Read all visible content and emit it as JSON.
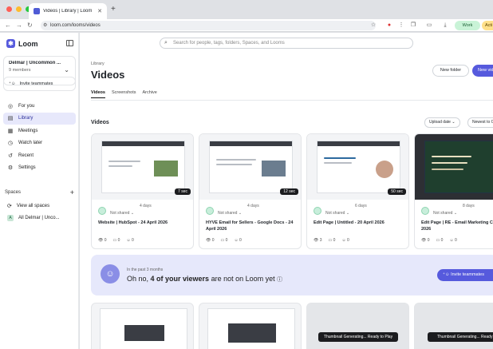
{
  "browser": {
    "tab_title": "Videos | Library | Loom",
    "url": "loom.com/looms/videos",
    "profile_work": "Work",
    "profile_acti": "Acti"
  },
  "sidebar": {
    "brand": "Loom",
    "workspace_name": "Delmar | Uncommon ...",
    "workspace_members": "9 members",
    "invite_label": "Invite teammates",
    "items": [
      {
        "label": "For you",
        "icon": "user-circle-icon"
      },
      {
        "label": "Library",
        "icon": "library-icon",
        "active": true
      },
      {
        "label": "Meetings",
        "icon": "calendar-icon"
      },
      {
        "label": "Watch later",
        "icon": "clock-icon"
      },
      {
        "label": "Recent",
        "icon": "history-icon"
      },
      {
        "label": "Settings",
        "icon": "gear-icon"
      }
    ],
    "spaces_label": "Spaces",
    "space_items": [
      {
        "label": "View all spaces",
        "icon": "spaces-icon"
      },
      {
        "label": "All Delmar | Unco...",
        "avatar": "A"
      }
    ]
  },
  "main": {
    "search_placeholder": "Search for people, tags, folders, Spaces, and Looms",
    "breadcrumb": "Library",
    "title": "Videos",
    "new_folder": "New folder",
    "new_video": "New vid",
    "tabs": [
      "Videos",
      "Screenshots",
      "Archive"
    ],
    "section_title": "Videos",
    "sort_label": "Upload date",
    "order_label": "Newest to O",
    "cards": [
      {
        "ago": "4 days",
        "duration": "7 sec",
        "shared": "Not shared",
        "title": "Website | HubSpot - 24 April 2026",
        "views": "0",
        "comments": "0",
        "reactions": "0"
      },
      {
        "ago": "4 days",
        "duration": "12 sec",
        "shared": "Not shared",
        "title": "HYVE Email for Sellers - Google Docs - 24 April 2026",
        "views": "0",
        "comments": "0",
        "reactions": "0"
      },
      {
        "ago": "6 days",
        "duration": "50 sec",
        "shared": "Not shared",
        "title": "Edit Page | Untitled - 20 April 2026",
        "views": "3",
        "comments": "0",
        "reactions": "0"
      },
      {
        "ago": "8 days",
        "duration": "",
        "shared": "Not shared",
        "title": "Edit Page | RE - Email Marketing C 20 April 2026",
        "views": "0",
        "comments": "0",
        "reactions": "0"
      }
    ],
    "banner": {
      "subtitle": "In the past 3 months",
      "msg_prefix": "Oh no, ",
      "msg_bold": "4 of your viewers",
      "msg_suffix": " are not on Loom yet",
      "button": "Invite teammates"
    },
    "generating_label": "Thumbnail Generating... Ready to Play",
    "generating_label_2": "Thumbnail Generating... Ready to"
  }
}
